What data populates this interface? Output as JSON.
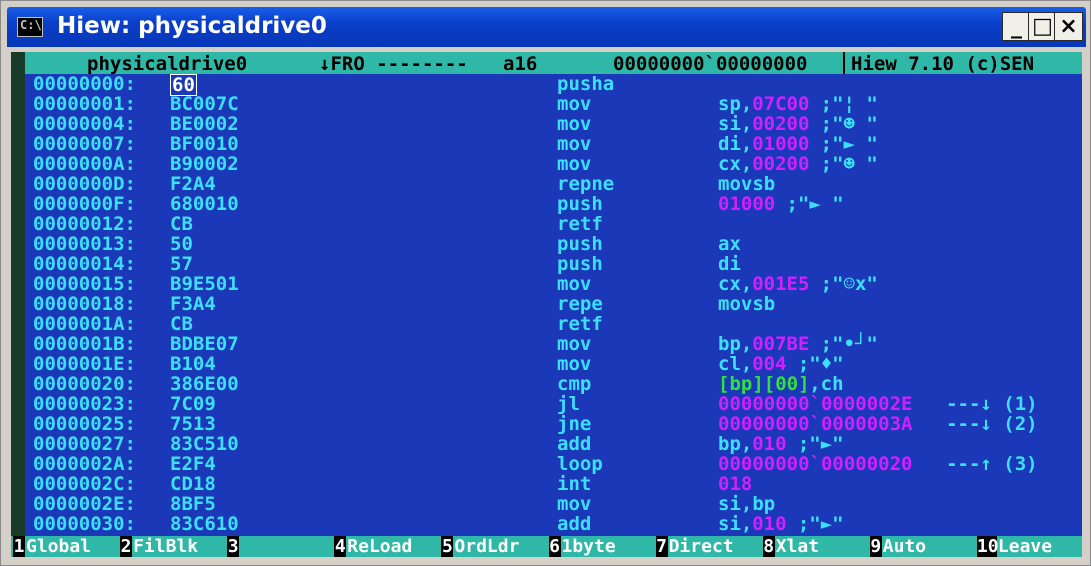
{
  "window": {
    "title": "Hiew: physicaldrive0",
    "icon_glyph": "C:\\",
    "controls": [
      "_",
      "□",
      "×"
    ]
  },
  "status": {
    "file": "physicaldrive0",
    "mode": "↓FRO --------",
    "bits": "a16",
    "offset": "00000000`00000000",
    "product": "Hiew 7.10 (c)SEN"
  },
  "disasm": [
    {
      "addr": "00000000:",
      "hex": "60",
      "mn": "pusha",
      "ops": []
    },
    {
      "addr": "00000001:",
      "hex": "BC007C",
      "mn": "mov",
      "ops": [
        {
          "t": "sp,",
          "c": "op"
        },
        {
          "t": "07C00",
          "c": "num"
        },
        {
          "t": " ;\"¦ \"",
          "c": "op"
        }
      ]
    },
    {
      "addr": "00000004:",
      "hex": "BE0002",
      "mn": "mov",
      "ops": [
        {
          "t": "si,",
          "c": "op"
        },
        {
          "t": "00200",
          "c": "num"
        },
        {
          "t": " ;\"☻ \"",
          "c": "op"
        }
      ]
    },
    {
      "addr": "00000007:",
      "hex": "BF0010",
      "mn": "mov",
      "ops": [
        {
          "t": "di,",
          "c": "op"
        },
        {
          "t": "01000",
          "c": "num"
        },
        {
          "t": " ;\"► \"",
          "c": "op"
        }
      ]
    },
    {
      "addr": "0000000A:",
      "hex": "B90002",
      "mn": "mov",
      "ops": [
        {
          "t": "cx,",
          "c": "op"
        },
        {
          "t": "00200",
          "c": "num"
        },
        {
          "t": " ;\"☻ \"",
          "c": "op"
        }
      ]
    },
    {
      "addr": "0000000D:",
      "hex": "F2A4",
      "mn": "repne",
      "ops": [
        {
          "t": "movsb",
          "c": "op"
        }
      ]
    },
    {
      "addr": "0000000F:",
      "hex": "680010",
      "mn": "push",
      "ops": [
        {
          "t": "01000",
          "c": "num"
        },
        {
          "t": " ;\"► \"",
          "c": "op"
        }
      ]
    },
    {
      "addr": "00000012:",
      "hex": "CB",
      "mn": "retf",
      "ops": []
    },
    {
      "addr": "00000013:",
      "hex": "50",
      "mn": "push",
      "ops": [
        {
          "t": "ax",
          "c": "op"
        }
      ]
    },
    {
      "addr": "00000014:",
      "hex": "57",
      "mn": "push",
      "ops": [
        {
          "t": "di",
          "c": "op"
        }
      ]
    },
    {
      "addr": "00000015:",
      "hex": "B9E501",
      "mn": "mov",
      "ops": [
        {
          "t": "cx,",
          "c": "op"
        },
        {
          "t": "001E5",
          "c": "num"
        },
        {
          "t": " ;\"☺x\"",
          "c": "op"
        }
      ]
    },
    {
      "addr": "00000018:",
      "hex": "F3A4",
      "mn": "repe",
      "ops": [
        {
          "t": "movsb",
          "c": "op"
        }
      ]
    },
    {
      "addr": "0000001A:",
      "hex": "CB",
      "mn": "retf",
      "ops": []
    },
    {
      "addr": "0000001B:",
      "hex": "BDBE07",
      "mn": "mov",
      "ops": [
        {
          "t": "bp,",
          "c": "op"
        },
        {
          "t": "007BE",
          "c": "num"
        },
        {
          "t": " ;\"•┘\"",
          "c": "op"
        }
      ]
    },
    {
      "addr": "0000001E:",
      "hex": "B104",
      "mn": "mov",
      "ops": [
        {
          "t": "cl,",
          "c": "op"
        },
        {
          "t": "004",
          "c": "num"
        },
        {
          "t": " ;\"♦\"",
          "c": "op"
        }
      ]
    },
    {
      "addr": "00000020:",
      "hex": "386E00",
      "mn": "cmp",
      "ops": [
        {
          "t": "[bp][00]",
          "c": "grn"
        },
        {
          "t": ",ch",
          "c": "op"
        }
      ]
    },
    {
      "addr": "00000023:",
      "hex": "7C09",
      "mn": "jl",
      "ops": [
        {
          "t": "00000000`0000002E",
          "c": "num"
        },
        {
          "t": "   ---↓ (1)",
          "c": "op"
        }
      ]
    },
    {
      "addr": "00000025:",
      "hex": "7513",
      "mn": "jne",
      "ops": [
        {
          "t": "00000000`0000003A",
          "c": "num"
        },
        {
          "t": "   ---↓ (2)",
          "c": "op"
        }
      ]
    },
    {
      "addr": "00000027:",
      "hex": "83C510",
      "mn": "add",
      "ops": [
        {
          "t": "bp,",
          "c": "op"
        },
        {
          "t": "010",
          "c": "num"
        },
        {
          "t": " ;\"►\"",
          "c": "op"
        }
      ]
    },
    {
      "addr": "0000002A:",
      "hex": "E2F4",
      "mn": "loop",
      "ops": [
        {
          "t": "00000000`00000020",
          "c": "num"
        },
        {
          "t": "   ---↑ (3)",
          "c": "op"
        }
      ]
    },
    {
      "addr": "0000002C:",
      "hex": "CD18",
      "mn": "int",
      "ops": [
        {
          "t": "018",
          "c": "num"
        }
      ]
    },
    {
      "addr": "0000002E:",
      "hex": "8BF5",
      "mn": "mov",
      "ops": [
        {
          "t": "si,bp",
          "c": "op"
        }
      ]
    },
    {
      "addr": "00000030:",
      "hex": "83C610",
      "mn": "add",
      "ops": [
        {
          "t": "si,",
          "c": "op"
        },
        {
          "t": "010",
          "c": "num"
        },
        {
          "t": " ;\"►\"",
          "c": "op"
        }
      ]
    }
  ],
  "fkeys": [
    {
      "n": "1",
      "label": "Global"
    },
    {
      "n": "2",
      "label": "FilBlk"
    },
    {
      "n": "3",
      "label": ""
    },
    {
      "n": "4",
      "label": "ReLoad"
    },
    {
      "n": "5",
      "label": "OrdLdr"
    },
    {
      "n": "6",
      "label": "1byte"
    },
    {
      "n": "7",
      "label": "Direct"
    },
    {
      "n": "8",
      "label": "Xlat"
    },
    {
      "n": "9",
      "label": "Auto"
    },
    {
      "n": "10",
      "label": "Leave"
    }
  ],
  "colors": {
    "screen_bg": "#1a38b8",
    "text": "#3ce0ff",
    "number": "#d020ff",
    "memory_ref": "#30e040",
    "bar": "#2fb8a8",
    "titlebar": "#0a3ec9"
  }
}
